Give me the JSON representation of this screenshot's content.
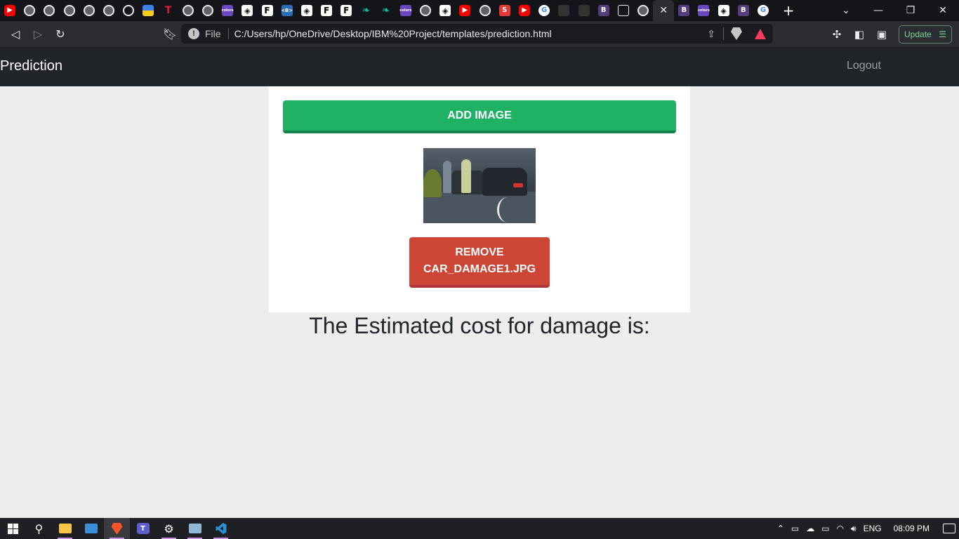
{
  "browser": {
    "tabs": [
      {
        "icon": "youtube-icon",
        "glyph": "▶",
        "cls": "yt"
      },
      {
        "icon": "globe-icon",
        "glyph": "",
        "cls": "globe"
      },
      {
        "icon": "globe-icon",
        "glyph": "",
        "cls": "globe"
      },
      {
        "icon": "globe-icon",
        "glyph": "",
        "cls": "globe"
      },
      {
        "icon": "globe-icon",
        "glyph": "",
        "cls": "globe"
      },
      {
        "icon": "globe-icon",
        "glyph": "",
        "cls": "globe"
      },
      {
        "icon": "gauge-icon",
        "glyph": "",
        "cls": "gauge"
      },
      {
        "icon": "ua-flag-icon",
        "glyph": "",
        "cls": "ua"
      },
      {
        "icon": "tesla-icon",
        "glyph": "T",
        "cls": "tesla"
      },
      {
        "icon": "globe-icon",
        "glyph": "",
        "cls": "globe"
      },
      {
        "icon": "globe-icon",
        "glyph": "",
        "cls": "globe"
      },
      {
        "icon": "coloris-icon",
        "glyph": "colors",
        "cls": "coloris"
      },
      {
        "icon": "codepen-icon",
        "glyph": "◈",
        "cls": "codepen"
      },
      {
        "icon": "f-icon",
        "glyph": "F",
        "cls": "f"
      },
      {
        "icon": "bootstrap-div-icon",
        "glyph": "<B>",
        "cls": "bsdiv"
      },
      {
        "icon": "codepen-icon",
        "glyph": "◈",
        "cls": "codepen"
      },
      {
        "icon": "f-icon",
        "glyph": "F",
        "cls": "f"
      },
      {
        "icon": "f-icon",
        "glyph": "F",
        "cls": "f"
      },
      {
        "icon": "leaf-icon",
        "glyph": "❧",
        "cls": "leaf"
      },
      {
        "icon": "leaf-icon",
        "glyph": "❧",
        "cls": "leaf"
      },
      {
        "icon": "coloris-icon",
        "glyph": "colors",
        "cls": "coloris"
      },
      {
        "icon": "globe-icon",
        "glyph": "",
        "cls": "globe"
      },
      {
        "icon": "codepen-icon",
        "glyph": "◈",
        "cls": "codepen"
      },
      {
        "icon": "youtube-icon",
        "glyph": "▶",
        "cls": "yt"
      },
      {
        "icon": "globe-icon",
        "glyph": "",
        "cls": "globe"
      },
      {
        "icon": "s-icon",
        "glyph": "S",
        "cls": "s"
      },
      {
        "icon": "youtube-icon",
        "glyph": "▶",
        "cls": "yt"
      },
      {
        "icon": "google-icon",
        "glyph": "G",
        "cls": "g"
      },
      {
        "icon": "dark-app-icon",
        "glyph": "",
        "cls": "dark"
      },
      {
        "icon": "dark-app-icon",
        "glyph": "",
        "cls": "dark"
      },
      {
        "icon": "bootstrap-icon",
        "glyph": "B",
        "cls": "b"
      },
      {
        "icon": "cube-icon",
        "glyph": "",
        "cls": "cube"
      },
      {
        "icon": "globe-icon",
        "glyph": "",
        "cls": "globe"
      },
      {
        "icon": "close-icon",
        "glyph": "✕",
        "cls": "close",
        "active": true
      },
      {
        "icon": "bootstrap-icon",
        "glyph": "B",
        "cls": "b"
      },
      {
        "icon": "coloris-icon",
        "glyph": "colors",
        "cls": "coloris"
      },
      {
        "icon": "codepen-icon",
        "glyph": "◈",
        "cls": "codepen"
      },
      {
        "icon": "bootstrap-icon",
        "glyph": "B",
        "cls": "b"
      },
      {
        "icon": "google-icon",
        "glyph": "G",
        "cls": "g"
      }
    ],
    "new_tab": "+",
    "file_label": "File",
    "url": "C:/Users/hp/OneDrive/Desktop/IBM%20Project/templates/prediction.html",
    "update_label": "Update"
  },
  "navbar": {
    "brand": "Prediction",
    "logout": "Logout"
  },
  "upload": {
    "add_label": "ADD IMAGE",
    "remove_label": "REMOVE CAR_DAMAGE1.JPG",
    "image_alt": "car damage photo"
  },
  "result": {
    "text": "The Estimated cost for damage is:"
  },
  "taskbar": {
    "language": "ENG",
    "time": "08:09 PM"
  },
  "colors": {
    "add_button": "#1fb264",
    "remove_button": "#cd4535",
    "navbar": "#212529",
    "page_bg": "#ededed"
  }
}
